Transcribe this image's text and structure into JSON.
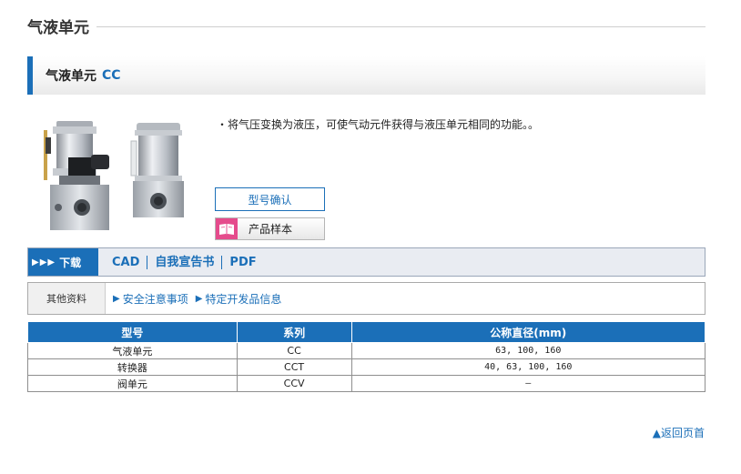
{
  "page": {
    "title": "气液单元"
  },
  "product": {
    "name": "气液单元",
    "code": "CC",
    "description": "・将气压变换为液压，可使气动元件获得与液压单元相同的功能。。"
  },
  "buttons": {
    "model_confirm": "型号确认",
    "catalog": "产品样本"
  },
  "download": {
    "label": "下载",
    "arrows": "▶▶▶",
    "links": [
      "CAD",
      "自我宣告书",
      "PDF"
    ]
  },
  "other": {
    "label": "其他资料",
    "links": [
      "安全注意事项",
      "特定开发品信息"
    ]
  },
  "table": {
    "headers": [
      "型号",
      "系列",
      "公称直径(mm)"
    ],
    "rows": [
      [
        "气液单元",
        "CC",
        "63, 100, 160"
      ],
      [
        "转换器",
        "CCT",
        "40, 63, 100, 160"
      ],
      [
        "阀单元",
        "CCV",
        "—"
      ]
    ]
  },
  "footer": {
    "back_to_top": "▲返回页首"
  },
  "colors": {
    "accent": "#1b6fb8",
    "catalog_icon": "#e54b8c"
  }
}
